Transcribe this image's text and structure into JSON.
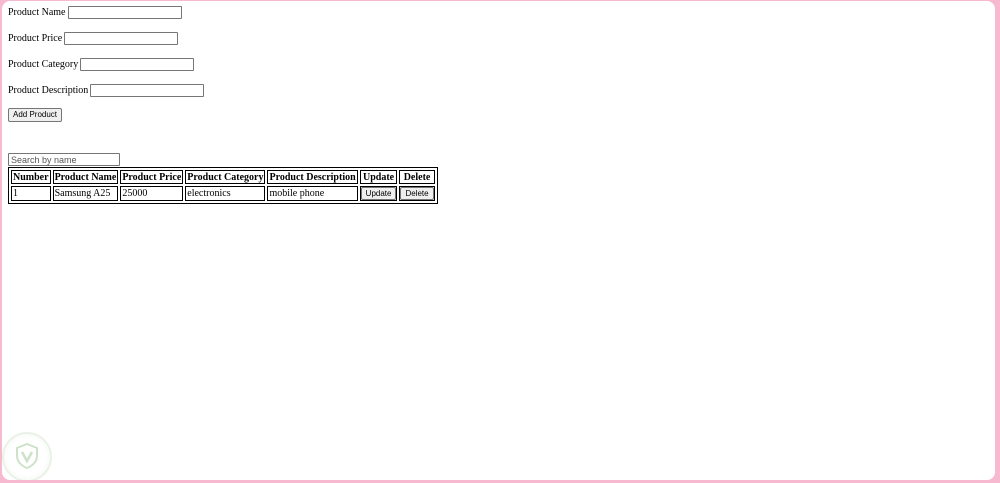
{
  "form": {
    "name_label": "Product Name",
    "price_label": "Product Price",
    "category_label": "Product Category",
    "description_label": "Product Description",
    "name_value": "",
    "price_value": "",
    "category_value": "",
    "description_value": "",
    "add_button": "Add Product"
  },
  "search": {
    "placeholder": "Search by name",
    "value": ""
  },
  "table": {
    "headers": [
      "Number",
      "Product Name",
      "Product Price",
      "Product Category",
      "Product Description",
      "Update",
      "Delete"
    ],
    "rows": [
      {
        "number": "1",
        "name": "Samsung A25",
        "price": "25000",
        "category": "electronics",
        "description": "mobile phone",
        "update_label": "Update",
        "delete_label": "Delete"
      }
    ]
  },
  "colors": {
    "frame_border": "#f7b9cf",
    "watermark": "#c9dfc4"
  },
  "icons": {
    "watermark": "shield-logo-icon"
  }
}
